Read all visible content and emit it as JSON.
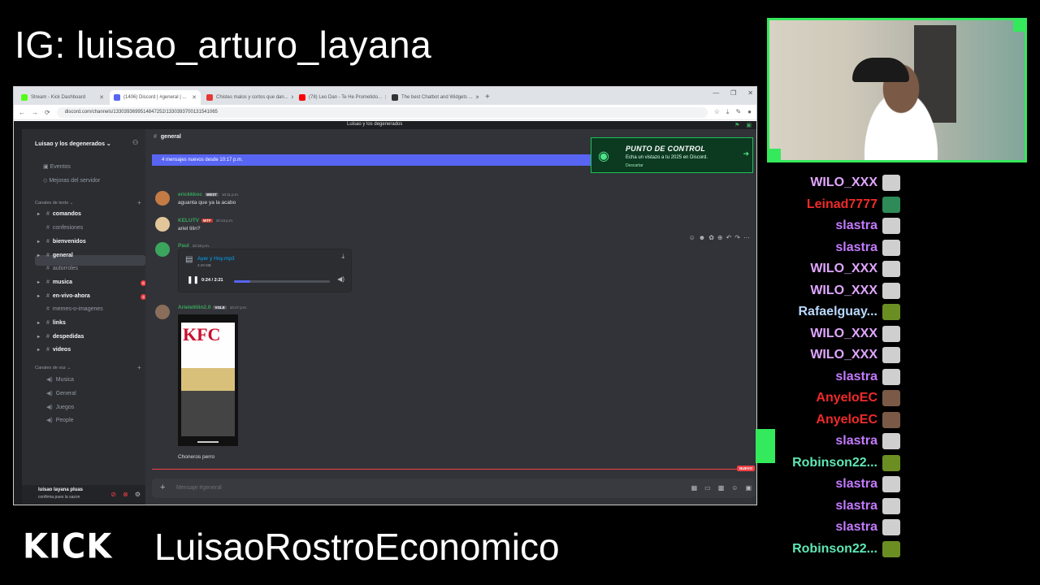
{
  "overlay": {
    "ig_handle": "IG: luisao_arturo_layana",
    "kick_logo": "KICK",
    "channel_name": "LuisaoRostroEconomico"
  },
  "browser": {
    "tabs": [
      {
        "label": "Stream - Kick Dashboard",
        "color": "#53fc18"
      },
      {
        "label": "(1406) Discord | #general | ...",
        "color": "#5865f2"
      },
      {
        "label": "Chistes malos y cortos que dan...",
        "color": "#e53935"
      },
      {
        "label": "(78) Leo Dan - Te He Prometido...",
        "color": "#ff0000"
      },
      {
        "label": "The best Chatbot and Widgets ...",
        "color": "#333333"
      }
    ],
    "url": "discord.com/channels/1330393699514847252/1330393700131541065"
  },
  "discord": {
    "window_title": "Luisao y los degenerados",
    "server_name": "Luisao y los degenerados ⌄",
    "side_top": [
      "Eventos",
      "Mejoras del servidor"
    ],
    "text_category": "Canales de texto ⌄",
    "text_channels": [
      "comandos",
      "confesiones",
      "bienvenidos",
      "general",
      "autorroles",
      "musica",
      "en-vivo-ahora",
      "memes-o-imagenes",
      "links",
      "despedidas",
      "videos"
    ],
    "voice_category": "Canales de voz ⌄",
    "voice_channels": [
      "Musica",
      "General",
      "Juegos",
      "People"
    ],
    "user_name": "luisao layana pluas",
    "user_status": "confirma pues la sazon",
    "channel_header": "general",
    "new_messages_bar": "4 mensajes nuevos desde 10:17 p.m.",
    "promo": {
      "title": "PUNTO DE CONTROL",
      "subtitle": "Echa un vistazo a tu 2025 en Discord.",
      "link": "Descartar"
    },
    "messages": [
      {
        "author": "erickkkoc",
        "tag": "WEST",
        "time": "10:11 p.m.",
        "text": "aguanta que ya la acabo",
        "color": "#3ba55d"
      },
      {
        "author": "KELUTV",
        "tag": "WTF",
        "time": "10:13 p.m.",
        "text": "ariel tilin?",
        "color": "#3ba55d"
      },
      {
        "author": "Paul",
        "tag": "",
        "time": "10:16 p.m.",
        "text": "",
        "color": "#3ba55d"
      },
      {
        "author": "Arieleltilin2.0",
        "tag": "VGLE",
        "time": "10:17 p.m.",
        "text": "Choneros perro",
        "color": "#3ba55d"
      }
    ],
    "audio": {
      "name": "Ayer y Hoy.mp3",
      "size": "3.29 MB",
      "time": "0:24 / 2:21",
      "progress": 0.17
    },
    "video_text": "KFC",
    "new_label": "NUEVO",
    "composer_placeholder": "Mensaje #general"
  },
  "chat": [
    {
      "user": "WILO_XXX",
      "color": "#e0a6ff",
      "emote": "#cfcfcf"
    },
    {
      "user": "Leinad7777",
      "color": "#f02a2a",
      "emote": "#2e8b57"
    },
    {
      "user": "slastra",
      "color": "#c47bff",
      "emote": "#cfcfcf"
    },
    {
      "user": "slastra",
      "color": "#c47bff",
      "emote": "#cfcfcf"
    },
    {
      "user": "WILO_XXX",
      "color": "#e0a6ff",
      "emote": "#cfcfcf"
    },
    {
      "user": "WILO_XXX",
      "color": "#e0a6ff",
      "emote": "#cfcfcf"
    },
    {
      "user": "Rafaelguay...",
      "color": "#b8d9ff",
      "emote": "#6b8e23"
    },
    {
      "user": "WILO_XXX",
      "color": "#e0a6ff",
      "emote": "#cfcfcf"
    },
    {
      "user": "WILO_XXX",
      "color": "#e0a6ff",
      "emote": "#cfcfcf"
    },
    {
      "user": "slastra",
      "color": "#c47bff",
      "emote": "#cfcfcf"
    },
    {
      "user": "AnyeloEC",
      "color": "#f02a2a",
      "emote": "#7a5a46"
    },
    {
      "user": "AnyeloEC",
      "color": "#f02a2a",
      "emote": "#7a5a46"
    },
    {
      "user": "slastra",
      "color": "#c47bff",
      "emote": "#cfcfcf"
    },
    {
      "user": "Robinson22...",
      "color": "#5ee8b5",
      "emote": "#6b8e23"
    },
    {
      "user": "slastra",
      "color": "#c47bff",
      "emote": "#cfcfcf"
    },
    {
      "user": "slastra",
      "color": "#c47bff",
      "emote": "#cfcfcf"
    },
    {
      "user": "slastra",
      "color": "#c47bff",
      "emote": "#cfcfcf"
    },
    {
      "user": "Robinson22...",
      "color": "#5ee8b5",
      "emote": "#6b8e23"
    }
  ]
}
